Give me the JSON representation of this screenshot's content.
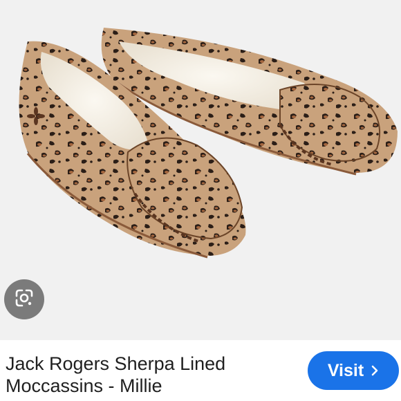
{
  "image": {
    "subject": "leopard-print-moccasins"
  },
  "lens_button": {
    "icon": "google-lens-icon"
  },
  "product": {
    "title": "Jack Rogers Sherpa Lined Moccassins - Millie"
  },
  "visit_button": {
    "label": "Visit",
    "icon": "chevron-right-icon",
    "color": "#1a73e8"
  }
}
